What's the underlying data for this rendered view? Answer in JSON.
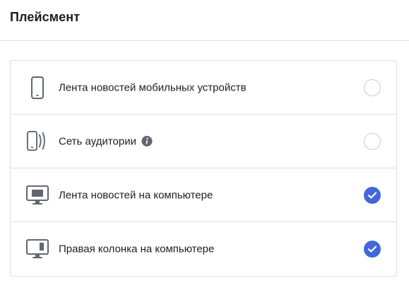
{
  "header": {
    "title": "Плейсмент"
  },
  "placements": [
    {
      "label": "Лента новостей мобильных устройств",
      "icon": "mobile-phone-icon",
      "selected": false,
      "has_info": false
    },
    {
      "label": "Сеть аудитории",
      "icon": "audience-network-icon",
      "selected": false,
      "has_info": true
    },
    {
      "label": "Лента новостей на компьютере",
      "icon": "desktop-feed-icon",
      "selected": true,
      "has_info": false
    },
    {
      "label": "Правая колонка на компьютере",
      "icon": "desktop-right-column-icon",
      "selected": true,
      "has_info": false
    }
  ],
  "colors": {
    "accent": "#4267d8",
    "border": "#dddfe2",
    "icon": "#606770"
  }
}
